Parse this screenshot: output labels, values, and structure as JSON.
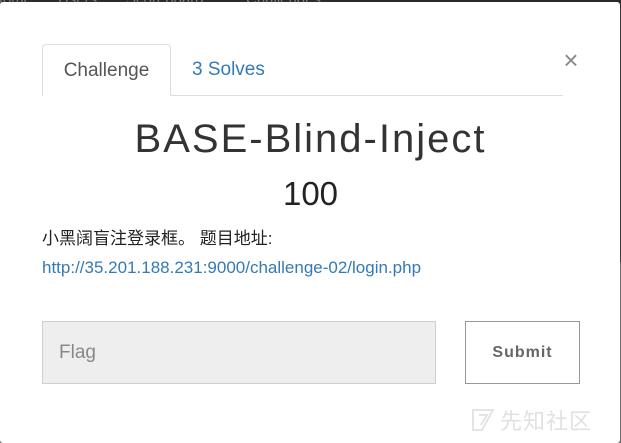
{
  "backdrop": {
    "nav_items": [
      "Home",
      "Users",
      "Scoreboard",
      "Challenges"
    ]
  },
  "modal": {
    "tabs": [
      {
        "label": "Challenge",
        "active": true
      },
      {
        "label": "3 Solves",
        "active": false
      }
    ],
    "close_label": "×",
    "title": "BASE-Blind-Inject",
    "points": "100",
    "description": "小黑阔盲注登录框。 题目地址:",
    "link_text": "http://35.201.188.231:9000/challenge-02/login.php",
    "flag_input": {
      "value": "",
      "placeholder": "Flag"
    },
    "submit_label": "Submit"
  },
  "watermark": {
    "text": "先知社区",
    "icon": "xianzhi-logo-icon"
  },
  "colors": {
    "link": "#337ab7",
    "text": "#333333",
    "input_bg": "#eeeeee"
  }
}
